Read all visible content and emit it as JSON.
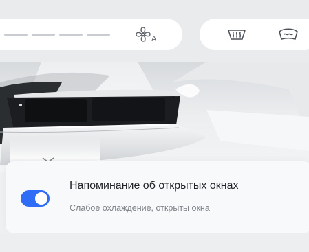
{
  "climate_bar": {
    "fan_mode_label": "A",
    "fan_icon": "fan-auto-icon",
    "rear_defrost_icon": "rear-defrost-icon",
    "front_defrost_icon": "front-defrost-icon"
  },
  "notification": {
    "title": "Напоминание об открытых окнах",
    "subtitle": "Слабое охлаждение, открыты окна",
    "toggle_on": true,
    "accent_color": "#2f6df6"
  }
}
